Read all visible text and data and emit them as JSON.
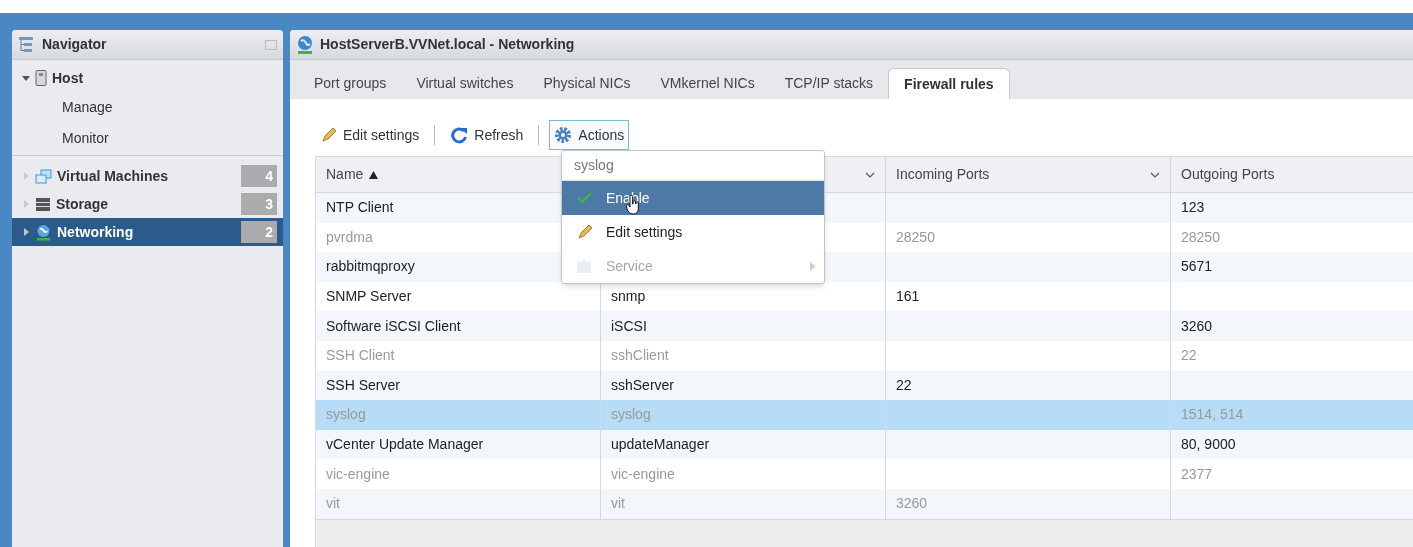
{
  "navigator": {
    "title": "Navigator",
    "items": [
      {
        "label": "Host",
        "kind": "host",
        "expanded": true,
        "selected": false,
        "children": [
          {
            "label": "Manage"
          },
          {
            "label": "Monitor"
          }
        ]
      },
      {
        "label": "Virtual Machines",
        "kind": "vms",
        "expanded": false,
        "selected": false,
        "count": "4"
      },
      {
        "label": "Storage",
        "kind": "storage",
        "expanded": false,
        "selected": false,
        "count": "3"
      },
      {
        "label": "Networking",
        "kind": "network",
        "expanded": false,
        "selected": true,
        "count": "2"
      }
    ]
  },
  "main": {
    "title": "HostServerB.VVNet.local - Networking",
    "tabs": [
      {
        "label": "Port groups",
        "selected": false
      },
      {
        "label": "Virtual switches",
        "selected": false
      },
      {
        "label": "Physical NICs",
        "selected": false
      },
      {
        "label": "VMkernel NICs",
        "selected": false
      },
      {
        "label": "TCP/IP stacks",
        "selected": false
      },
      {
        "label": "Firewall rules",
        "selected": true
      }
    ],
    "toolbar": [
      {
        "label": "Edit settings",
        "kind": "edit",
        "active": false
      },
      {
        "label": "Refresh",
        "kind": "refresh",
        "active": false
      },
      {
        "label": "Actions",
        "kind": "actions",
        "active": true
      }
    ],
    "table": {
      "columns": [
        {
          "label": "Name",
          "sorted_ascending": true
        },
        {
          "menu": true
        },
        {
          "label": "Incoming Ports",
          "menu": true
        },
        {
          "label": "Outgoing Ports"
        }
      ],
      "rows": [
        {
          "cells": [
            "NTP Client",
            "",
            "",
            "123"
          ],
          "enabled": true,
          "selected": false
        },
        {
          "cells": [
            "pvrdma",
            "",
            "28250",
            "28250"
          ],
          "enabled": false,
          "selected": false
        },
        {
          "cells": [
            "rabbitmqproxy",
            "",
            "",
            "5671"
          ],
          "enabled": true,
          "selected": false
        },
        {
          "cells": [
            "SNMP Server",
            "snmp",
            "161",
            ""
          ],
          "enabled": true,
          "selected": false
        },
        {
          "cells": [
            "Software iSCSI Client",
            "iSCSI",
            "",
            "3260"
          ],
          "enabled": true,
          "selected": false
        },
        {
          "cells": [
            "SSH Client",
            "sshClient",
            "",
            "22"
          ],
          "enabled": false,
          "selected": false
        },
        {
          "cells": [
            "SSH Server",
            "sshServer",
            "22",
            ""
          ],
          "enabled": true,
          "selected": false
        },
        {
          "cells": [
            "syslog",
            "syslog",
            "",
            "1514, 514"
          ],
          "enabled": false,
          "selected": true
        },
        {
          "cells": [
            "vCenter Update Manager",
            "updateManager",
            "",
            "80, 9000"
          ],
          "enabled": true,
          "selected": false
        },
        {
          "cells": [
            "vic-engine",
            "vic-engine",
            "",
            "2377"
          ],
          "enabled": false,
          "selected": false
        },
        {
          "cells": [
            "vit",
            "vit",
            "3260",
            ""
          ],
          "enabled": false,
          "selected": false
        }
      ]
    },
    "menu": {
      "header": "syslog",
      "items": [
        {
          "label": "Enable",
          "kind": "check",
          "selected": true,
          "disabled": false,
          "submenu": false
        },
        {
          "label": "Edit settings",
          "kind": "edit",
          "selected": false,
          "disabled": false,
          "submenu": false
        },
        {
          "label": "Service",
          "kind": "service",
          "selected": false,
          "disabled": true,
          "submenu": true
        }
      ]
    }
  }
}
